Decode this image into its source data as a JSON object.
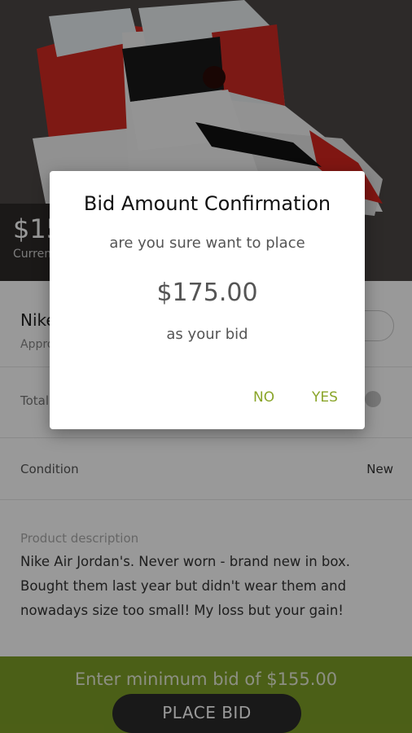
{
  "product": {
    "price": "$155.00",
    "price_label": "Current bid",
    "title": "Nike Air Jordan",
    "subtitle": "Approx. size",
    "total_label": "Total bids",
    "condition_label": "Condition",
    "condition_value": "New",
    "description_label": "Product description",
    "description": "Nike Air Jordan's. Never worn - brand new in box. Bought them last year but didn't wear them and nowadays size too small! My loss but your gain!"
  },
  "bottom": {
    "min_bid_text": "Enter minimum bid of $155.00",
    "place_bid_label": "PLACE BID"
  },
  "dialog": {
    "title": "Bid Amount Confirmation",
    "line1": "are you sure want to place",
    "amount": "$175.00",
    "line2": "as your bid",
    "no_label": "NO",
    "yes_label": "YES"
  },
  "colors": {
    "accent": "#8aa52a",
    "bottom_bar": "#7e9e27",
    "dark": "#2a2a2a"
  }
}
